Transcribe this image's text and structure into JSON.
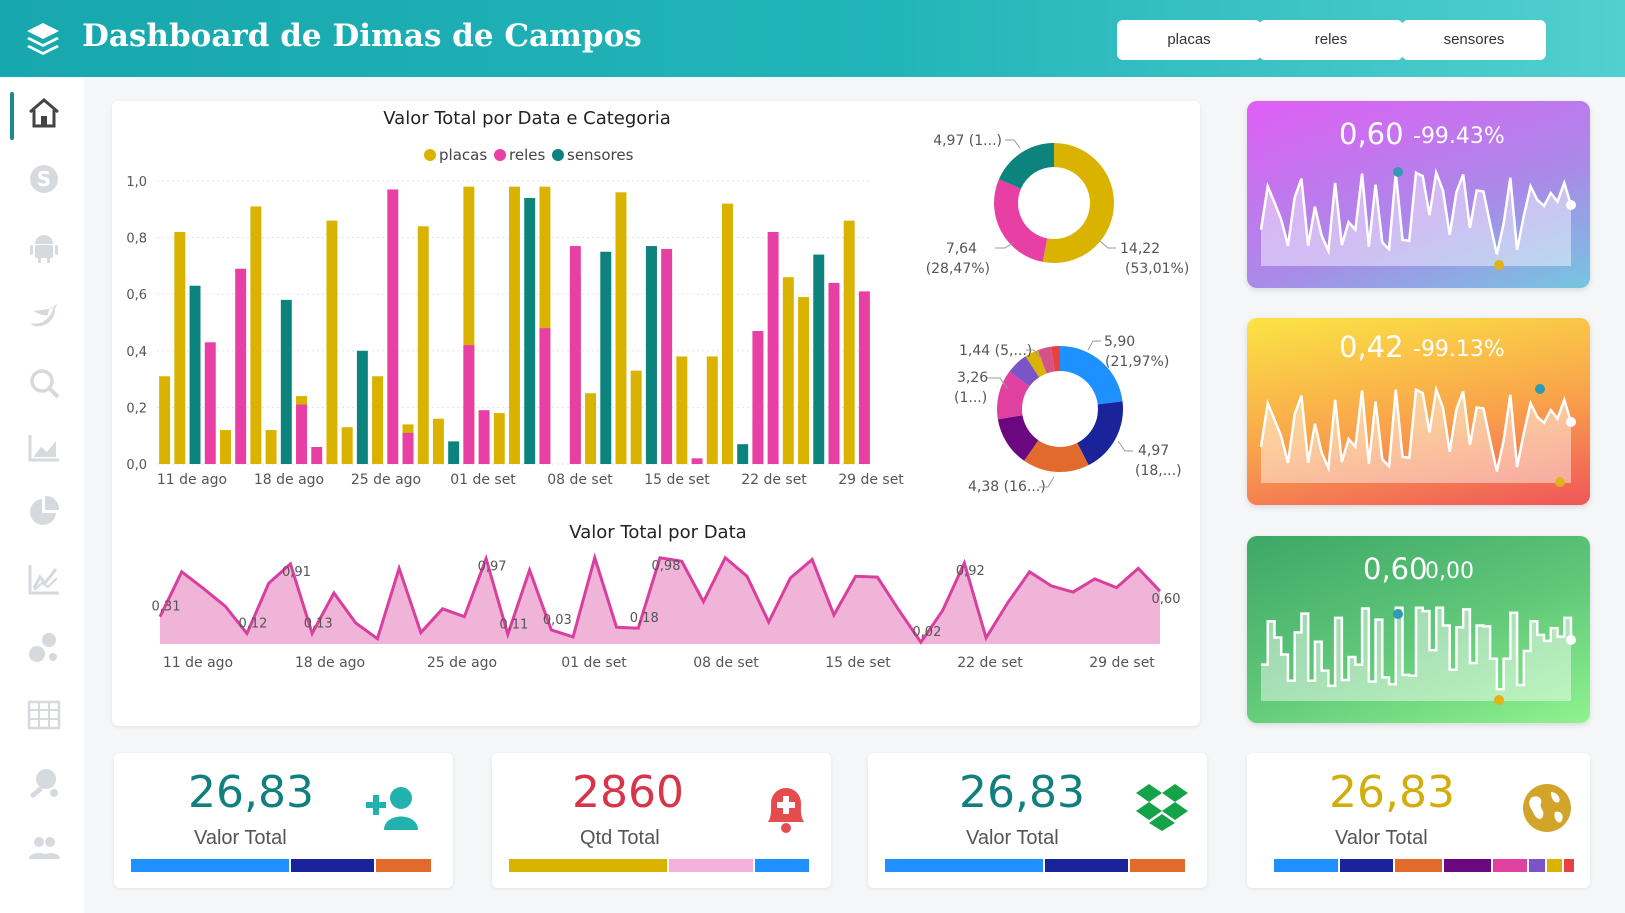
{
  "header": {
    "title": "Dashboard de Dimas de Campos",
    "buttons": [
      "placas",
      "reles",
      "sensores"
    ]
  },
  "sidebar": {
    "icons": [
      "home-icon",
      "skype-icon",
      "android-icon",
      "twitter-icon",
      "search-icon",
      "area-chart-icon",
      "pie-chart-icon",
      "line-chart-icon",
      "bubbles-icon",
      "table-icon",
      "ping-pong-icon",
      "users-icon"
    ]
  },
  "colors": {
    "placas": "#d9b300",
    "reles": "#e83fa5",
    "sensores": "#0d837e",
    "teal_text": "#127f7f",
    "red_text": "#d9354a",
    "gold_text": "#d2ad0e"
  },
  "bar_chart": {
    "title": "Valor Total por Data e Categoria",
    "legend": [
      "placas",
      "reles",
      "sensores"
    ],
    "y_ticks": [
      "1,0",
      "0,8",
      "0,6",
      "0,4",
      "0,2",
      "0,0"
    ],
    "x_labels": [
      "11 de ago",
      "18 de ago",
      "25 de ago",
      "01 de set",
      "08 de set",
      "15 de set",
      "22 de set",
      "29 de set"
    ]
  },
  "donut1": {
    "labels": [
      {
        "line1": "4,97 (1...)",
        "line2": ""
      },
      {
        "line1": "7,64",
        "line2": "(28,47%)"
      },
      {
        "line1": "14,22",
        "line2": "(53,01%)"
      }
    ]
  },
  "donut2": {
    "labels": [
      {
        "line1": "1,44 (5,...)",
        "line2": ""
      },
      {
        "line1": "3,26",
        "line2": "(1...)"
      },
      {
        "line1": "4,38 (16...)",
        "line2": ""
      },
      {
        "line1": "5,90",
        "line2": "(21,97%)"
      },
      {
        "line1": "4,97",
        "line2": "(18,...)"
      }
    ]
  },
  "area_chart": {
    "title": "Valor Total por Data",
    "x_labels": [
      "11 de ago",
      "18 de ago",
      "25 de ago",
      "01 de set",
      "08 de set",
      "15 de set",
      "22 de set",
      "29 de set"
    ],
    "point_labels": [
      "0,31",
      "0,12",
      "0,91",
      "0,13",
      "0,97",
      "0,11",
      "0,03",
      "0,98",
      "0,18",
      "0,02",
      "0,92",
      "0,60"
    ]
  },
  "sparks": [
    {
      "value": "0,60",
      "delta": "-99.43%"
    },
    {
      "value": "0,42",
      "delta": "-99.13%"
    },
    {
      "value": "0,60",
      "delta": "0,00"
    }
  ],
  "kpis": [
    {
      "value": "26,83",
      "label": "Valor Total",
      "icon": "add-user-icon"
    },
    {
      "value": "2860",
      "label": "Qtd Total",
      "icon": "bell-plus-icon"
    },
    {
      "value": "26,83",
      "label": "Valor Total",
      "icon": "dropbox-icon"
    },
    {
      "value": "26,83",
      "label": "Valor Total",
      "icon": "globe-icon"
    }
  ],
  "chart_data": [
    {
      "type": "bar",
      "title": "Valor Total por Data e Categoria",
      "legend_position": "top",
      "ylim": [
        0,
        1.0
      ],
      "x_tick_labels": [
        "11 de ago",
        "18 de ago",
        "25 de ago",
        "01 de set",
        "08 de set",
        "15 de set",
        "22 de set",
        "29 de set"
      ],
      "series": [
        {
          "name": "placas",
          "color": "#d9b300",
          "values": [
            0.31,
            0.82,
            0,
            0,
            0.12,
            0,
            0.91,
            0.12,
            0,
            0.24,
            0,
            0.86,
            0.13,
            0,
            0.31,
            0,
            0.14,
            0.84,
            0.16,
            0,
            0.98,
            0,
            0.18,
            0.98,
            0,
            0.98,
            0,
            0.66,
            0.25,
            0,
            0.96,
            0.33,
            0,
            0,
            0.38,
            0,
            0.38,
            0.92,
            0,
            0.15,
            0,
            0.66,
            0.59,
            0,
            0.58,
            0.86,
            0
          ]
        },
        {
          "name": "reles",
          "color": "#e83fa5",
          "values": [
            0,
            0,
            0,
            0.43,
            0,
            0.69,
            0,
            0,
            0,
            0.21,
            0.06,
            0,
            0,
            0,
            0,
            0.97,
            0.11,
            0,
            0,
            0,
            0.42,
            0.19,
            0,
            0,
            0,
            0.48,
            0,
            0.77,
            0,
            0,
            0,
            0,
            0.77,
            0.76,
            0,
            0.02,
            0,
            0,
            0,
            0.47,
            0.82,
            0,
            0,
            0,
            0.64,
            0,
            0.61
          ]
        },
        {
          "name": "sensores",
          "color": "#0d837e",
          "values": [
            0,
            0,
            0.63,
            0,
            0,
            0,
            0,
            0,
            0.58,
            0,
            0,
            0,
            0,
            0.4,
            0,
            0,
            0,
            0,
            0,
            0.08,
            0,
            0,
            0,
            0,
            0.94,
            0,
            0,
            0,
            0,
            0.75,
            0,
            0,
            0.77,
            0,
            0,
            0,
            0,
            0,
            0.07,
            0,
            0,
            0,
            0,
            0.74,
            0,
            0,
            0
          ]
        }
      ]
    },
    {
      "type": "pie",
      "title": "",
      "labels": [
        "placas",
        "reles",
        "sensores"
      ],
      "values": [
        14.22,
        7.64,
        4.97
      ],
      "colors": [
        "#d9b300",
        "#e83fa5",
        "#0d837e"
      ]
    },
    {
      "type": "pie",
      "title": "",
      "values": [
        5.9,
        4.97,
        4.38,
        3.26,
        3.26,
        1.44,
        0.89,
        0.89,
        0.58
      ],
      "colors": [
        "#1e90ff",
        "#1a2399",
        "#e26a2c",
        "#6b087f",
        "#e040a0",
        "#7b55c7",
        "#d9b300",
        "#d45286",
        "#e84142"
      ]
    },
    {
      "type": "area",
      "title": "Valor Total por Data",
      "x_tick_labels": [
        "11 de ago",
        "18 de ago",
        "25 de ago",
        "01 de set",
        "08 de set",
        "15 de set",
        "22 de set",
        "29 de set"
      ],
      "values": [
        0.31,
        0.82,
        0.63,
        0.43,
        0.12,
        0.69,
        0.91,
        0.12,
        0.58,
        0.24,
        0.06,
        0.86,
        0.13,
        0.4,
        0.31,
        0.97,
        0.11,
        0.84,
        0.16,
        0.08,
        0.98,
        0.19,
        0.18,
        0.98,
        0.94,
        0.48,
        0.98,
        0.77,
        0.25,
        0.75,
        0.96,
        0.33,
        0.77,
        0.76,
        0.38,
        0.02,
        0.38,
        0.92,
        0.07,
        0.47,
        0.82,
        0.66,
        0.59,
        0.74,
        0.64,
        0.86,
        0.6
      ]
    }
  ]
}
